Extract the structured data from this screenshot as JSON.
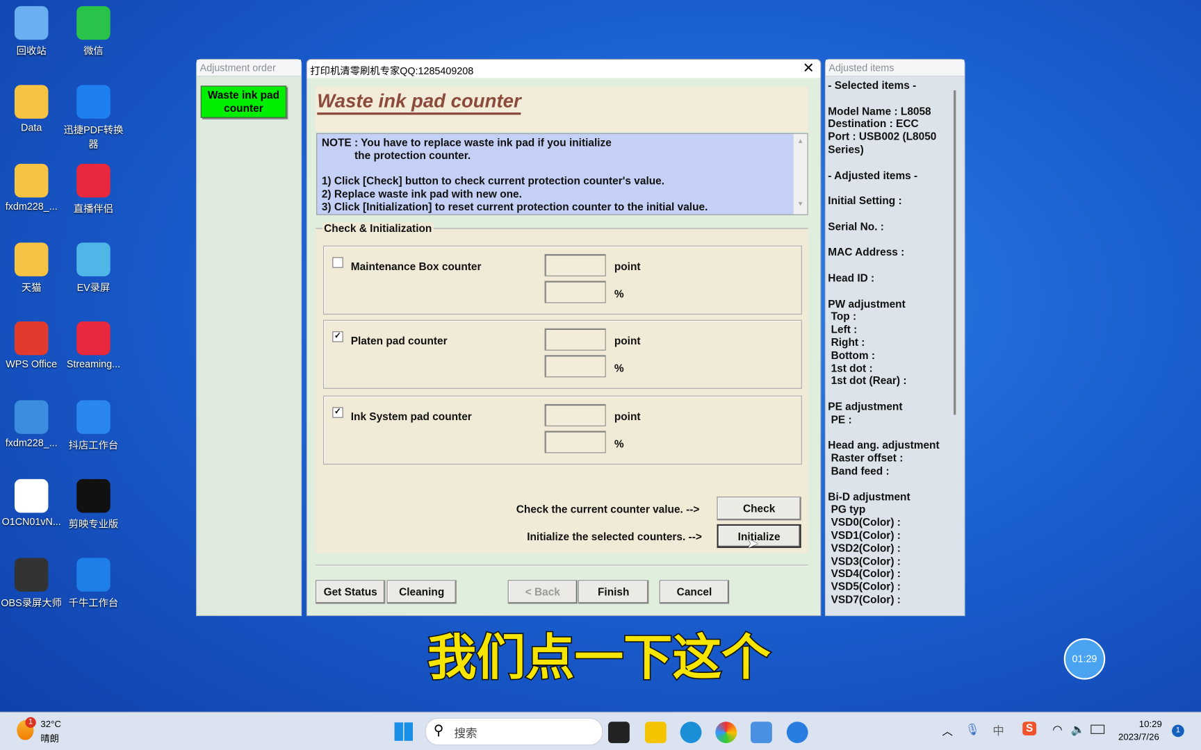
{
  "desktop_icons": [
    {
      "label": "回收站",
      "icon": "recycle-bin-icon"
    },
    {
      "label": "微信",
      "icon": "wechat-icon"
    },
    {
      "label": "Data",
      "icon": "folder-icon"
    },
    {
      "label": "迅捷PDF转换器",
      "icon": "pdf-converter-icon"
    },
    {
      "label": "fxdm228_...",
      "icon": "folder-icon"
    },
    {
      "label": "直播伴侣",
      "icon": "live-companion-icon"
    },
    {
      "label": "天猫",
      "icon": "folder-icon"
    },
    {
      "label": "EV录屏",
      "icon": "ev-recorder-icon"
    },
    {
      "label": "WPS Office",
      "icon": "wps-icon"
    },
    {
      "label": "Streaming...",
      "icon": "streaming-icon"
    },
    {
      "label": "fxdm228_...",
      "icon": "archive-icon"
    },
    {
      "label": "抖店工作台",
      "icon": "doudian-icon"
    },
    {
      "label": "O1CN01vN...",
      "icon": "file-icon"
    },
    {
      "label": "剪映专业版",
      "icon": "capcut-icon"
    },
    {
      "label": "OBS录屏大师",
      "icon": "obs-icon"
    },
    {
      "label": "千牛工作台",
      "icon": "qianniu-icon"
    }
  ],
  "left_panel": {
    "title": "Adjustment order",
    "item": "Waste ink pad counter"
  },
  "dialog": {
    "title": "打印机清零刷机专家QQ:1285409208",
    "heading": "Waste ink pad counter",
    "note": [
      "NOTE : You have to replace waste ink pad if you initialize",
      "           the protection counter.",
      "",
      "1) Click [Check] button to check current protection counter's value.",
      "2) Replace waste ink pad with new one.",
      "3) Click [Initialization] to reset current protection counter to the initial value."
    ],
    "group_title": "Check & Initialization",
    "counters": [
      {
        "label": "Maintenance Box counter",
        "checked": false,
        "point": "",
        "percent": ""
      },
      {
        "label": "Platen pad counter",
        "checked": true,
        "point": "",
        "percent": ""
      },
      {
        "label": "Ink System pad counter",
        "checked": true,
        "point": "",
        "percent": ""
      }
    ],
    "unit_point": "point",
    "unit_percent": "%",
    "check_prompt": "Check the current counter value. -->",
    "init_prompt": "Initialize the selected counters. -->",
    "check_button": "Check",
    "initialize_button": "Initialize",
    "buttons": {
      "get_status": "Get Status",
      "cleaning": "Cleaning",
      "back": "< Back",
      "finish": "Finish",
      "cancel": "Cancel"
    }
  },
  "right_panel": {
    "title": "Adjusted items",
    "lines": [
      "- Selected items -",
      "",
      "Model Name : L8058",
      "Destination : ECC",
      "Port : USB002 (L8050",
      "Series)",
      "",
      "- Adjusted items -",
      "",
      "Initial Setting :",
      "",
      "Serial No. :",
      "",
      "MAC Address :",
      "",
      "Head ID :",
      "",
      "PW adjustment",
      " Top :",
      " Left :",
      " Right :",
      " Bottom :",
      " 1st dot :",
      " 1st dot (Rear) :",
      "",
      "PE adjustment",
      " PE :",
      "",
      "Head ang. adjustment",
      " Raster offset :",
      " Band feed :",
      "",
      "Bi-D adjustment",
      " PG typ",
      " VSD0(Color) :",
      " VSD1(Color) :",
      " VSD2(Color) :",
      " VSD3(Color) :",
      " VSD4(Color) :",
      " VSD5(Color) :",
      " VSD7(Color) :"
    ]
  },
  "subtitle": "我们点一下这个",
  "timer": "01:29",
  "taskbar": {
    "weather_temp": "32°C",
    "weather_desc": "晴朗",
    "weather_badge": "1",
    "search_placeholder": "搜索",
    "time": "10:29",
    "date": "2023/7/26",
    "notification_count": "1"
  },
  "colors": {
    "accent_green": "#00ee00",
    "heading": "#8b4a3c",
    "note_bg": "#c4d0f5",
    "subtitle": "#f5e500"
  }
}
